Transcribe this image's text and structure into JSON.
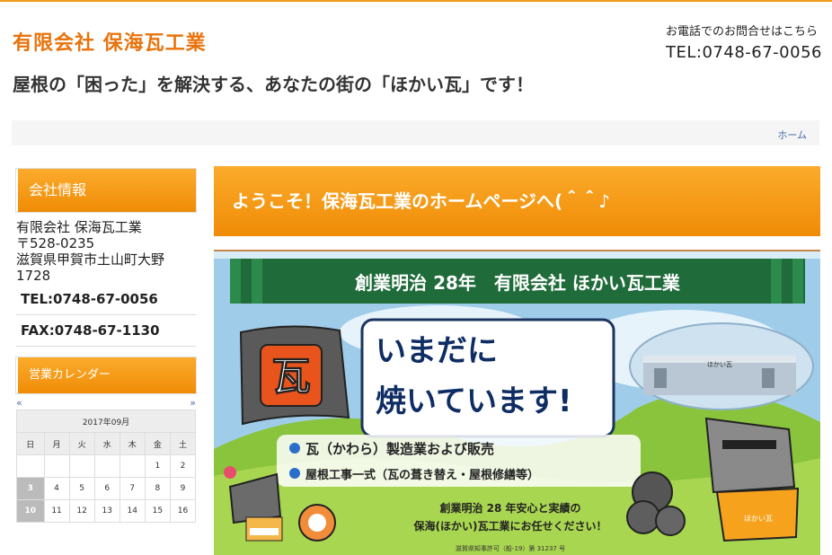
{
  "header": {
    "site_title": "有限会社 保海瓦工業",
    "tagline": "屋根の「困った」を解決する、あなたの街の「ほかい瓦」です！",
    "contact_label": "お電話でのお問合せはこちら",
    "contact_tel": "TEL:0748-67-0056"
  },
  "breadcrumb": {
    "home": "ホーム"
  },
  "sidebar": {
    "company_heading": "会社情報",
    "company_lines": [
      "有限会社 保海瓦工業",
      "〒528-0235",
      "滋賀県甲賀市土山町大野",
      "1728"
    ],
    "tel": "TEL:0748-67-0056",
    "fax": "FAX:0748-67-1130",
    "calendar_heading": "営業カレンダー",
    "calendar": {
      "prev": "«",
      "next": "»",
      "month": "2017年09月",
      "weekdays": [
        "日",
        "月",
        "火",
        "水",
        "木",
        "金",
        "土"
      ],
      "weeks": [
        [
          "",
          "",
          "",
          "",
          "",
          "1",
          "2"
        ],
        [
          "3",
          "4",
          "5",
          "6",
          "7",
          "8",
          "9"
        ],
        [
          "10",
          "11",
          "12",
          "13",
          "14",
          "15",
          "16"
        ]
      ],
      "holidays": [
        "3",
        "10"
      ]
    }
  },
  "main": {
    "heading": "ようこそ！保海瓦工業のホームページへ(＾＾♪",
    "banner": {
      "curtain_text": "創業明治 28年　有限会社 ほかい瓦工業",
      "badge_char": "瓦",
      "headline_1": "いまだに",
      "headline_2": "焼いています!",
      "factory_sign": "ほかい瓦",
      "bullet_1": "瓦（かわら）製造業および販売",
      "bullet_2": "屋根工事一式（瓦の葺き替え・屋根修繕等）",
      "promo_1": "創業明治 28 年安心と実績の",
      "promo_2": "保海(ほかい)瓦工業にお任せください！",
      "mascot_tag": "ほかい瓦",
      "license": "滋賀県知事許可（般-19）第 31237 号",
      "colors": {
        "curtain": "#1f6b3a",
        "badge": "#e8541c",
        "headline": "#0e2d63",
        "sky": "#9fcce8",
        "grass": "#8ac43c"
      }
    }
  }
}
